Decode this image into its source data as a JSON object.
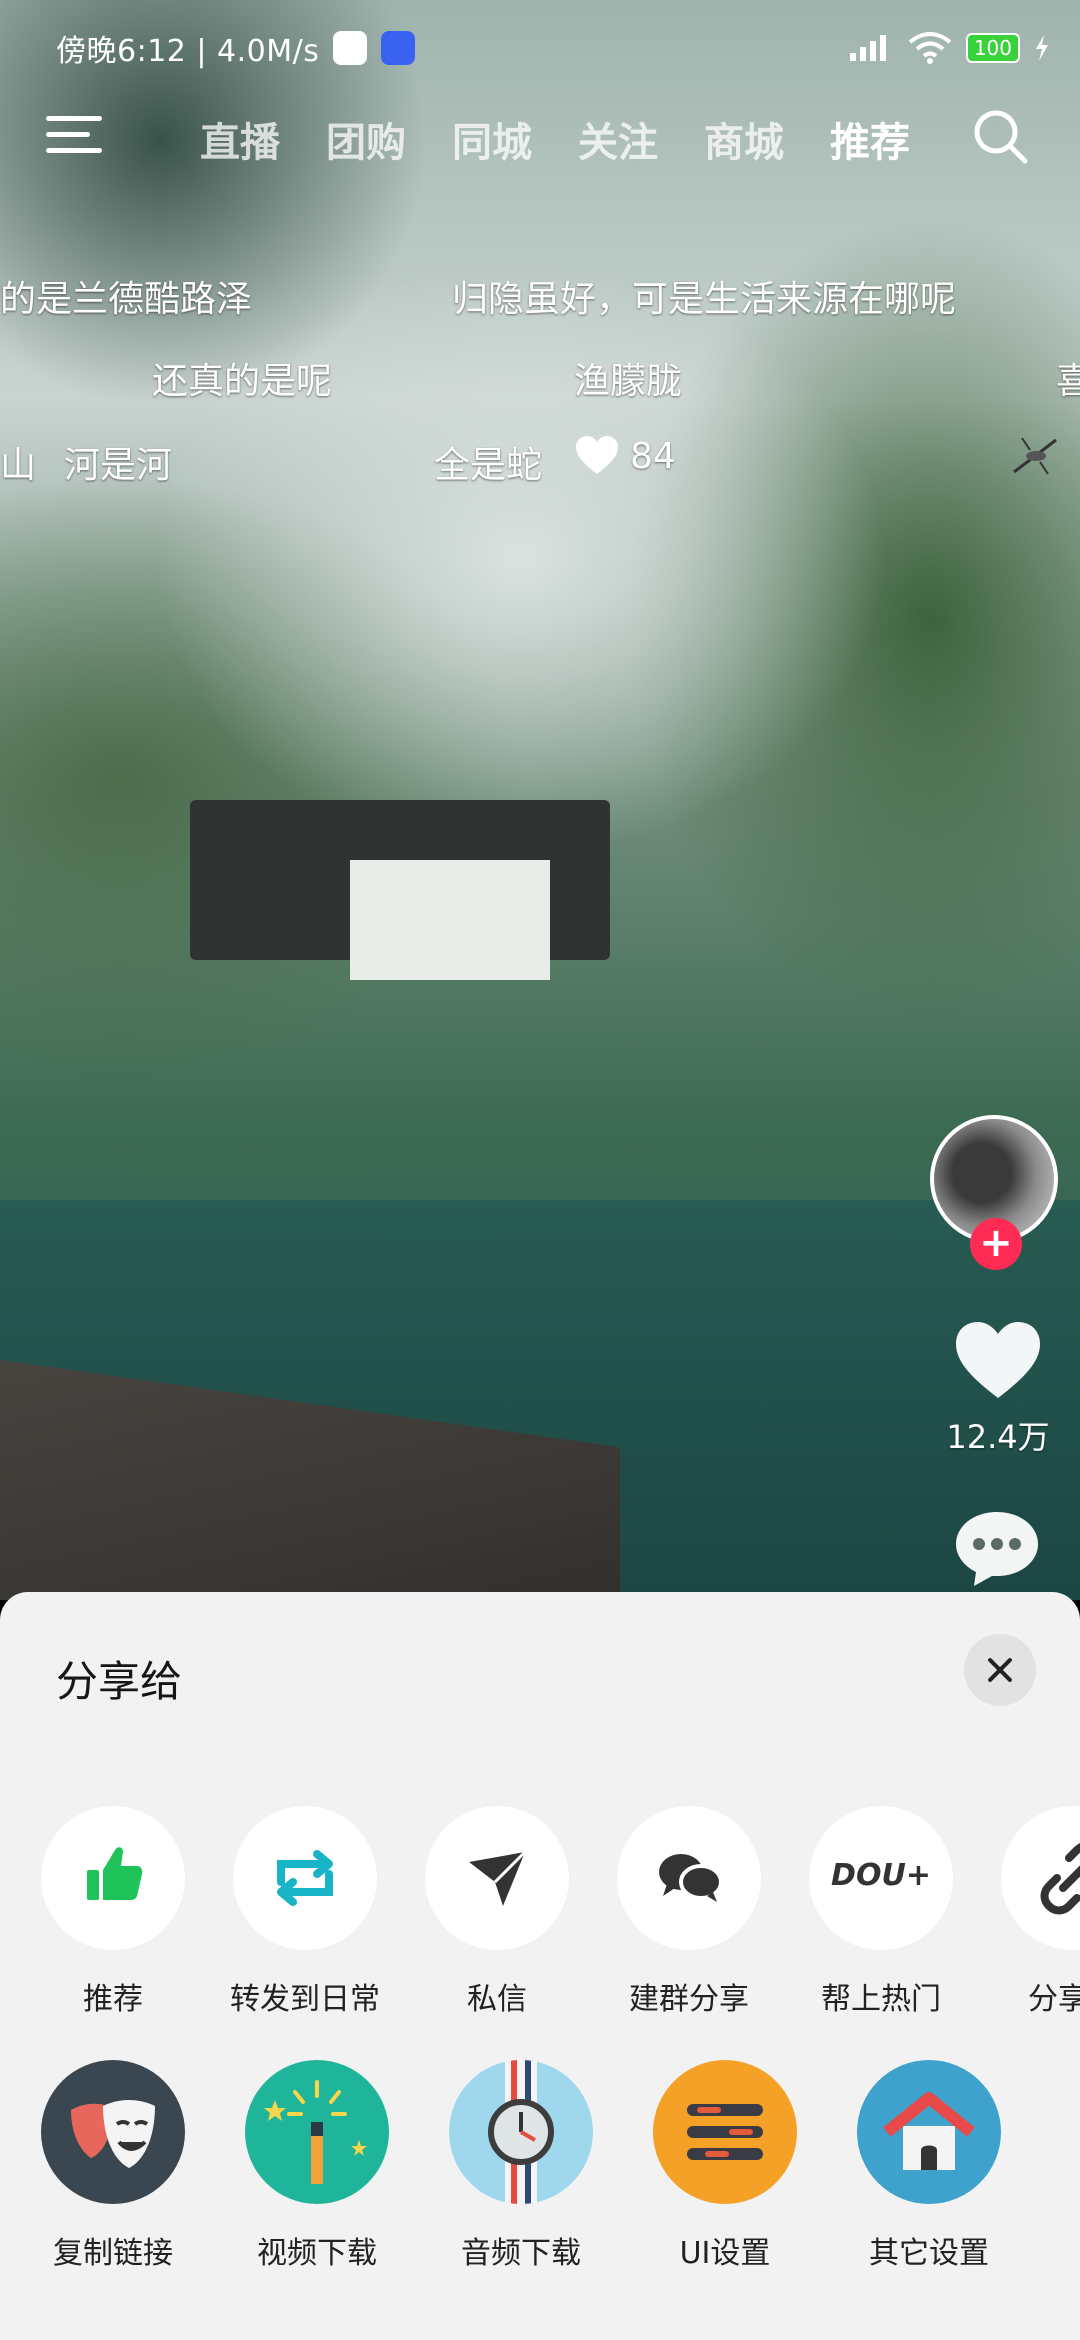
{
  "status_bar": {
    "time": "傍晚6:12 | 4.0M/s",
    "battery": "100"
  },
  "top_nav": {
    "tabs": [
      "直播",
      "团购",
      "同城",
      "关注",
      "商城",
      "推荐"
    ],
    "active_tab": "推荐"
  },
  "danmaku": [
    "的是兰德酷路泽",
    "归隐虽好，可是生活来源在哪呢",
    "还真的是呢",
    "渔朦胧",
    "喜",
    "山",
    "河是河",
    "全是蛇",
    "84"
  ],
  "side_actions": {
    "like_count": "12.4万"
  },
  "share_sheet": {
    "title": "分享给",
    "row1": [
      {
        "label": "推荐",
        "icon": "thumbs-up-icon"
      },
      {
        "label": "转发到日常",
        "icon": "repost-icon"
      },
      {
        "label": "私信",
        "icon": "send-icon"
      },
      {
        "label": "建群分享",
        "icon": "group-chat-icon"
      },
      {
        "label": "帮上热门",
        "icon": "dou-plus-icon",
        "icon_text": "DOU+"
      },
      {
        "label": "分享链",
        "icon": "link-icon"
      }
    ],
    "row2": [
      {
        "label": "复制链接",
        "icon": "theater-mask-icon"
      },
      {
        "label": "视频下载",
        "icon": "magic-wand-icon"
      },
      {
        "label": "音频下载",
        "icon": "watch-icon"
      },
      {
        "label": "UI设置",
        "icon": "list-icon"
      },
      {
        "label": "其它设置",
        "icon": "home-icon"
      }
    ]
  }
}
